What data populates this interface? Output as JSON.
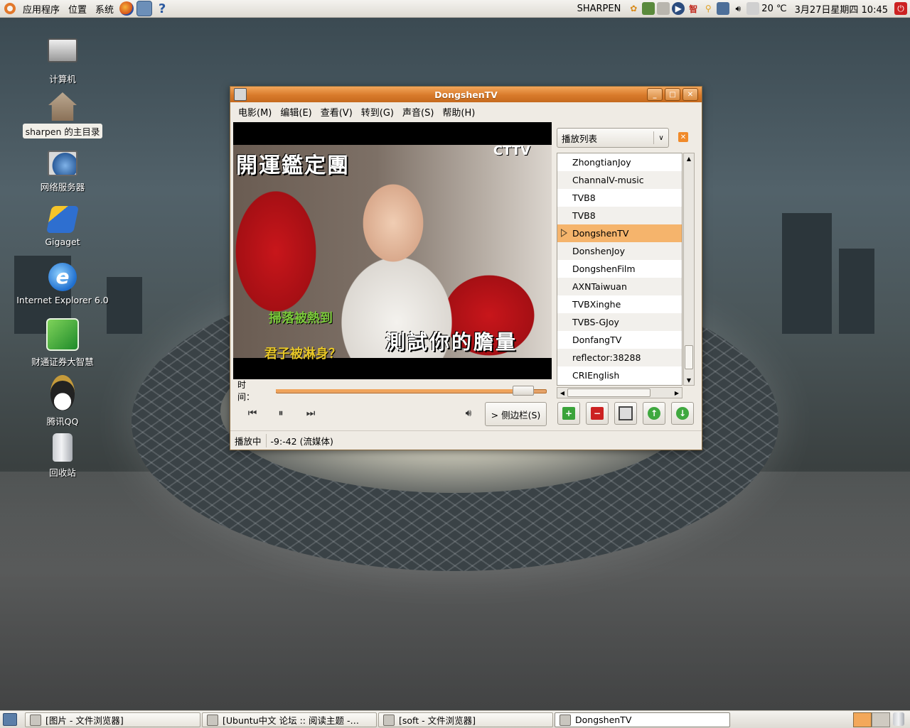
{
  "top_panel": {
    "menus": [
      "应用程序",
      "位置",
      "系统"
    ],
    "user": "SHARPEN",
    "weather": "20 ℃",
    "datetime": "3月27日星期四 10:45",
    "tray_icons": [
      "pidgin-icon",
      "stardict-icon",
      "printer-icon",
      "player-icon",
      "input-method-icon",
      "search-icon",
      "network-icon",
      "volume-icon"
    ]
  },
  "desktop_icons": [
    {
      "name": "computer-icon",
      "label": "计算机"
    },
    {
      "name": "home-folder-icon",
      "label": "sharpen 的主目录"
    },
    {
      "name": "network-servers-icon",
      "label": "网络服务器"
    },
    {
      "name": "gigaget-icon",
      "label": "Gigaget"
    },
    {
      "name": "ie-icon",
      "label": "Internet Explorer 6.0"
    },
    {
      "name": "stock-app-icon",
      "label": "财通证券大智慧"
    },
    {
      "name": "qq-icon",
      "label": "腾讯QQ"
    },
    {
      "name": "trash-icon",
      "label": "回收站"
    }
  ],
  "window": {
    "title": "DongshenTV",
    "menus": [
      "电影(M)",
      "编辑(E)",
      "查看(V)",
      "转到(G)",
      "声音(S)",
      "帮助(H)"
    ],
    "time_label": "时间：",
    "seek_progress": 0.93,
    "sidebar_button": "> 侧边栏(S)",
    "status_state": "播放中",
    "status_time": "-9:-42 (流媒体)"
  },
  "video": {
    "banner": "開運鑑定團",
    "logo": "CTTV",
    "caption_main": "測試你的膽量",
    "caption_green": "掃落被熱到",
    "caption_yellow": "君子被淋身？"
  },
  "playlist": {
    "selector": "播放列表",
    "items": [
      "ZhongtianJoy",
      "ChannalV-music",
      "TVB8",
      "TVB8",
      "DongshenTV",
      "DonshenJoy",
      "DongshenFilm",
      "AXNTaiwuan",
      "TVBXinghe",
      "TVBS-GJoy",
      "DonfangTV",
      "reflector:38288",
      "CRIEnglish"
    ],
    "active_index": 4
  },
  "taskbar": [
    {
      "label": "[图片 - 文件浏览器]",
      "active": false
    },
    {
      "label": "[Ubuntu中文 论坛 :: 阅读主题 -…",
      "active": false
    },
    {
      "label": "[soft - 文件浏览器]",
      "active": false
    },
    {
      "label": "DongshenTV",
      "active": true
    }
  ],
  "colors": {
    "accent": "#d87a2b",
    "panel": "#e9e7e1",
    "active_row": "#f5b46c"
  }
}
